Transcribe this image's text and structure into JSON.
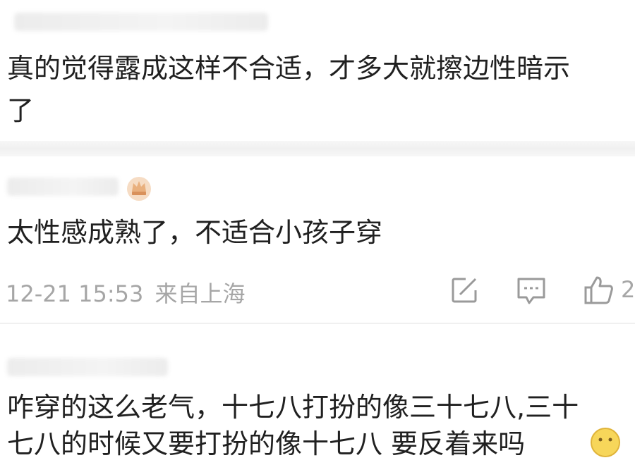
{
  "comments": [
    {
      "lines": [
        "真的觉得露成这样不合适，才多大就擦边性暗示",
        "了"
      ]
    },
    {
      "text": "太性感成熟了，不适合小孩子穿",
      "timestamp": "12-21 15:53",
      "location": "来自上海",
      "like_count": "2"
    },
    {
      "lines": [
        "咋穿的这么老气，十七八打扮的像三十七八,三十",
        "七八的时候又要打扮的像十七八 要反着来吗"
      ]
    }
  ],
  "icons": {
    "repost": "share-square-icon",
    "comment": "comment-bubble-icon",
    "like": "thumbs-up-icon",
    "badge": "crown-badge-icon",
    "emoji": "emoji-icon"
  },
  "colors": {
    "divider": "#f2f2f2",
    "meta_text": "#a6a6a6",
    "icon": "#9a9a9a"
  }
}
